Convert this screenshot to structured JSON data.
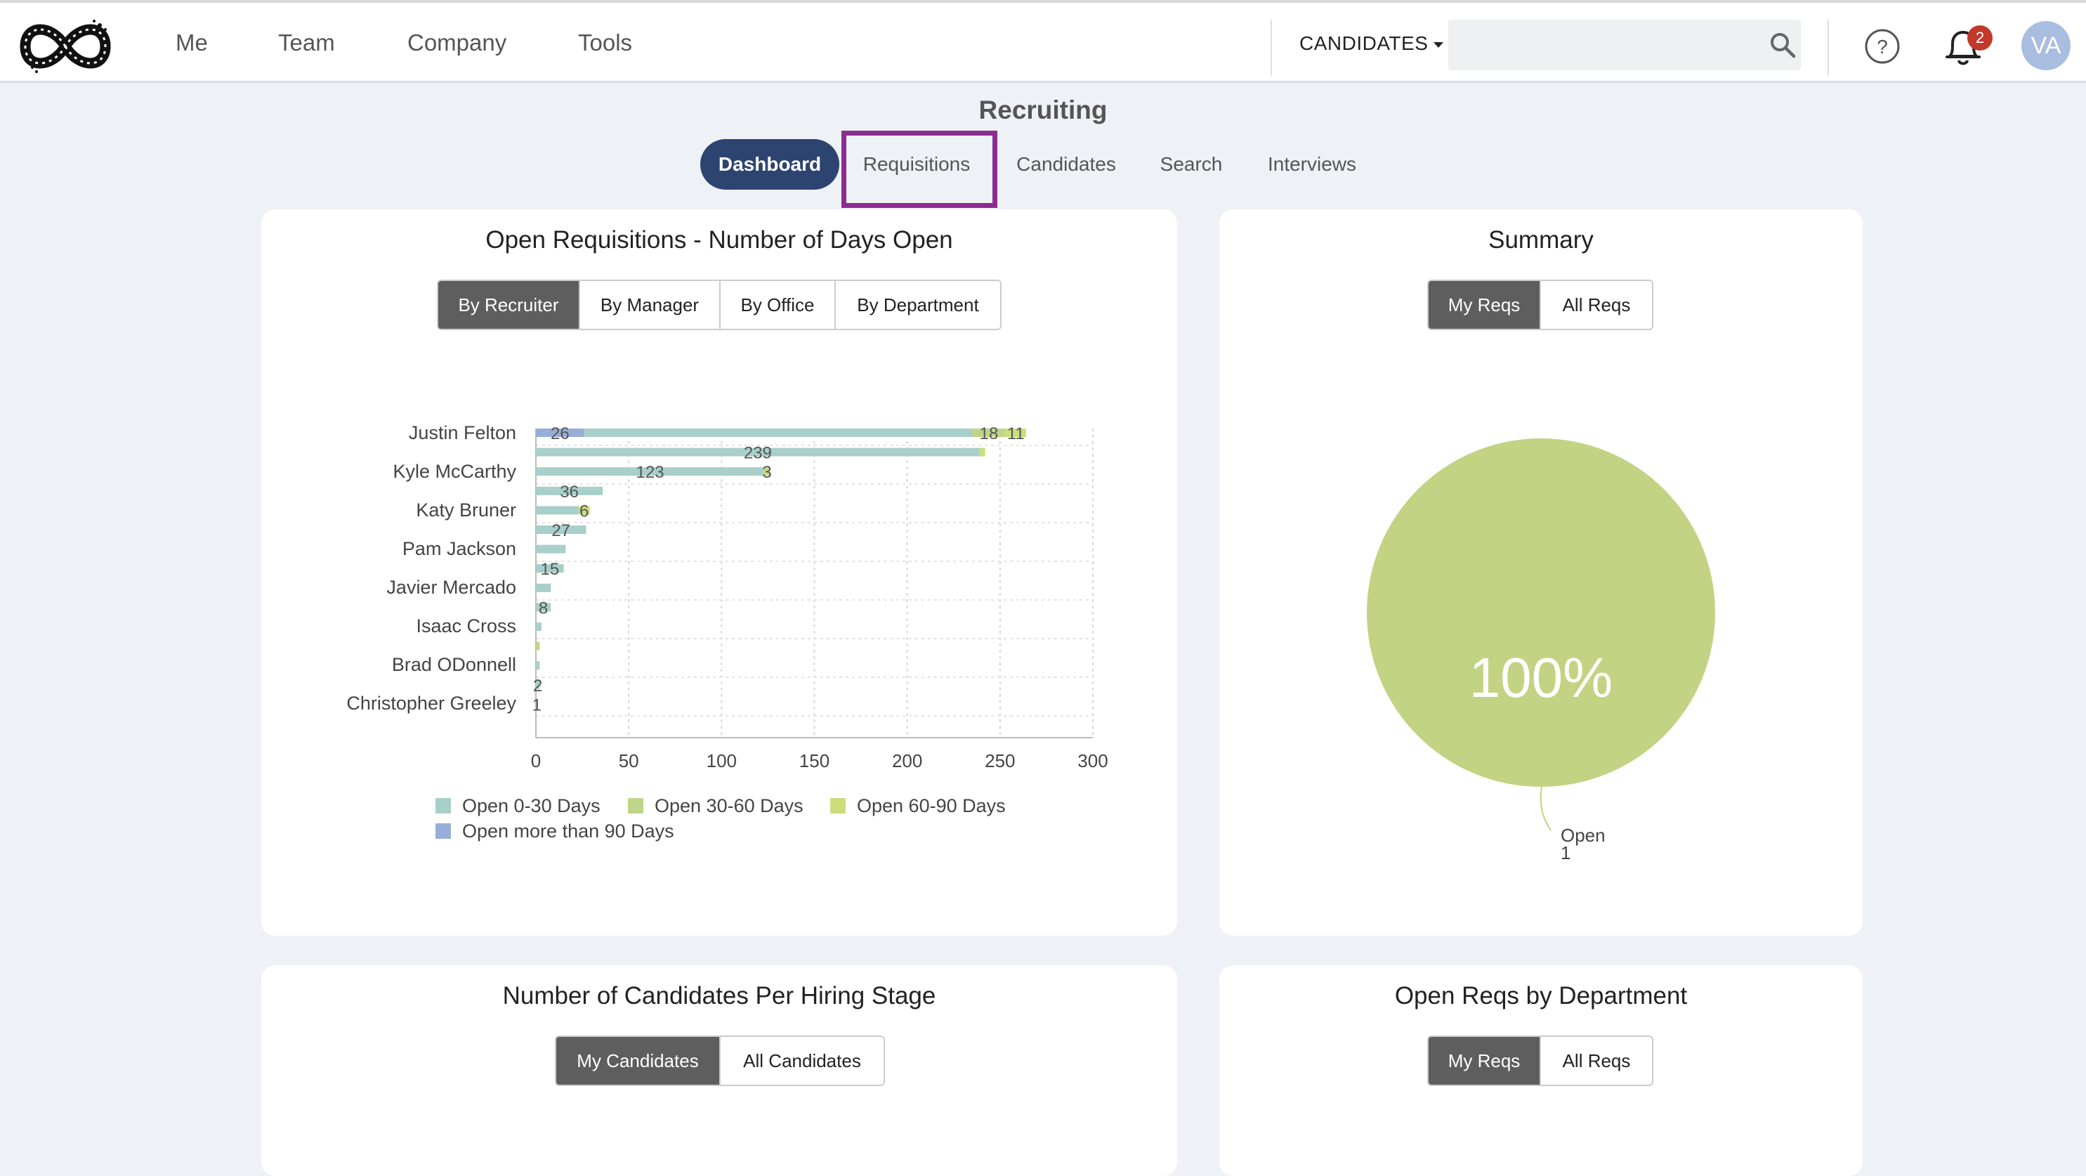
{
  "header": {
    "nav": [
      "Me",
      "Team",
      "Company",
      "Tools"
    ],
    "search_scope": "CANDIDATES",
    "search_placeholder": "",
    "notification_count": "2",
    "avatar_initials": "VA"
  },
  "page": {
    "title": "Recruiting",
    "tabs": [
      {
        "label": "Dashboard",
        "active": true
      },
      {
        "label": "Requisitions",
        "active": false
      },
      {
        "label": "Candidates",
        "active": false
      },
      {
        "label": "Search",
        "active": false
      },
      {
        "label": "Interviews",
        "active": false
      }
    ]
  },
  "cards": {
    "open_reqs": {
      "title": "Open Requisitions - Number of Days Open",
      "segments": [
        "By Recruiter",
        "By Manager",
        "By Office",
        "By Department"
      ]
    },
    "summary": {
      "title": "Summary",
      "segments": [
        "My Reqs",
        "All Reqs"
      ],
      "pie_label": "Open",
      "pie_value_label": "1",
      "pie_percent_label": "100%"
    },
    "hiring_stage": {
      "title": "Number of Candidates Per Hiring Stage",
      "segments": [
        "My Candidates",
        "All Candidates"
      ]
    },
    "by_department": {
      "title": "Open Reqs by Department",
      "segments": [
        "My Reqs",
        "All Reqs"
      ]
    }
  },
  "colors": {
    "accent_navy": "#2d4471",
    "highlight_purple": "#8b2c92",
    "badge_red": "#c0392b"
  },
  "chart_data": [
    {
      "type": "bar",
      "orientation": "horizontal",
      "stacked": true,
      "title": "Open Requisitions - Number of Days Open",
      "categories_visible": [
        "Justin Felton",
        "Kyle McCarthy",
        "Katy Bruner",
        "Pam Jackson",
        "Javier Mercado",
        "Isaac Cross",
        "Brad ODonnell",
        "Christopher Greeley"
      ],
      "x_ticks": [
        0,
        50,
        100,
        150,
        200,
        250,
        300
      ],
      "xlim": [
        0,
        300
      ],
      "grid": true,
      "legend_position": "bottom",
      "series_names": [
        "Open 0-30 Days",
        "Open 30-60 Days",
        "Open 60-90 Days",
        "Open more than 90 Days"
      ],
      "series_colors": [
        "#a8cfc9",
        "#bed68a",
        "#cade7c",
        "#97afd8"
      ],
      "rows": [
        {
          "segments": [
            209,
            18,
            11,
            26
          ],
          "labels": [
            "",
            "18",
            "11",
            "26"
          ]
        },
        {
          "segments": [
            239,
            0,
            3,
            0
          ],
          "labels": [
            "239",
            "",
            "",
            ""
          ]
        },
        {
          "segments": [
            123,
            0,
            3,
            0
          ],
          "labels": [
            "123",
            "",
            "3",
            ""
          ]
        },
        {
          "segments": [
            36,
            0,
            0,
            0
          ],
          "labels": [
            "36",
            "",
            "",
            ""
          ]
        },
        {
          "segments": [
            23,
            0,
            6,
            0
          ],
          "labels": [
            "",
            "",
            "6",
            ""
          ]
        },
        {
          "segments": [
            27,
            0,
            0,
            0
          ],
          "labels": [
            "27",
            "",
            "",
            ""
          ]
        },
        {
          "segments": [
            16,
            0,
            0,
            0
          ],
          "labels": [
            "",
            "",
            "",
            ""
          ]
        },
        {
          "segments": [
            15,
            0,
            0,
            0
          ],
          "labels": [
            "15",
            "",
            "",
            ""
          ]
        },
        {
          "segments": [
            8,
            0,
            0,
            0
          ],
          "labels": [
            "",
            "",
            "",
            ""
          ]
        },
        {
          "segments": [
            8,
            0,
            0,
            0
          ],
          "labels": [
            "8",
            "",
            "",
            ""
          ]
        },
        {
          "segments": [
            3,
            0,
            0,
            0
          ],
          "labels": [
            "",
            "",
            "",
            ""
          ]
        },
        {
          "segments": [
            0,
            2,
            0,
            0
          ],
          "labels": [
            "2",
            "",
            "",
            ""
          ]
        },
        {
          "segments": [
            2,
            0,
            0,
            0
          ],
          "labels": [
            "",
            "",
            "",
            ""
          ]
        },
        {
          "segments": [
            2,
            0,
            0,
            0
          ],
          "labels": [
            "2",
            "",
            "",
            ""
          ]
        },
        {
          "segments": [
            1,
            0,
            0,
            0
          ],
          "labels": [
            "1",
            "",
            "",
            ""
          ]
        }
      ]
    },
    {
      "type": "pie",
      "title": "Summary",
      "slices": [
        {
          "label": "Open",
          "value": 1,
          "percent": 100,
          "color": "#c2d383"
        }
      ]
    }
  ]
}
